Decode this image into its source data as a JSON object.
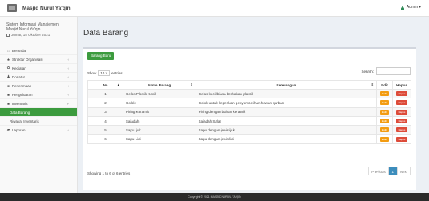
{
  "topbar": {
    "brand": "Masjid Nurul Ya'qin",
    "user": "Admin ▾"
  },
  "sidebar": {
    "system_name": "Sistem Informasi Manajemen Masjid Nurul Ya'qin",
    "date": "Jumat, 15 Oktober 2021",
    "items": [
      {
        "label": "Beranda",
        "icon": "⌂",
        "chevron": ""
      },
      {
        "label": "Struktur Organisasi",
        "icon": "♣",
        "chevron": "‹"
      },
      {
        "label": "Kegiatan",
        "icon": "✿",
        "chevron": "‹"
      },
      {
        "label": "Donatur",
        "icon": "♟",
        "chevron": "‹"
      },
      {
        "label": "Penerimaan",
        "icon": "■",
        "chevron": "‹"
      },
      {
        "label": "Pengeluaran",
        "icon": "■",
        "chevron": "‹"
      },
      {
        "label": "Inventaris",
        "icon": "■",
        "chevron": "˅"
      },
      {
        "label": "Data Barang",
        "icon": "",
        "chevron": ""
      },
      {
        "label": "Riwayat Inventaris",
        "icon": "",
        "chevron": ""
      },
      {
        "label": "Laporan",
        "icon": "▰",
        "chevron": "‹"
      }
    ]
  },
  "main": {
    "title": "Data Barang",
    "new_button": "Barang Baru",
    "show_label": "Show",
    "entries_value": "10",
    "entries_label": "entries",
    "search_label": "Search:",
    "columns": [
      "No",
      "Nama Barang",
      "Keterangan",
      "Edit",
      "Hapus"
    ],
    "rows": [
      {
        "no": "1",
        "nama": "Gelas Plastik Kecil",
        "ket": "Gelas kecil biasa berbahan plastik"
      },
      {
        "no": "2",
        "nama": "Golok",
        "ket": "Golok untuk keperluan penyembelihan hewan qurban"
      },
      {
        "no": "3",
        "nama": "Piring Keramik",
        "ket": "Piring dengan bahan keramik"
      },
      {
        "no": "4",
        "nama": "Sajadah",
        "ket": "Sajadah Salat"
      },
      {
        "no": "5",
        "nama": "Sapu Ijuk",
        "ket": "Sapu dengan jenis ijuk"
      },
      {
        "no": "6",
        "nama": "Sapu Lidi",
        "ket": "Sapu dengan jenis lidi"
      }
    ],
    "edit_label": "Edit",
    "hapus_label": "Hapus",
    "info": "Showing 1 to 6 of 6 entries",
    "pager": {
      "prev": "Previous",
      "page": "1",
      "next": "Next"
    }
  },
  "footer": {
    "text": "Copyright © 2021 MASJID NURUL YA'QIN"
  },
  "colors": {
    "accent_green": "#3c9b3e",
    "edit": "#f39c12",
    "hapus": "#dd4b39",
    "page_active": "#3c8dbc"
  }
}
